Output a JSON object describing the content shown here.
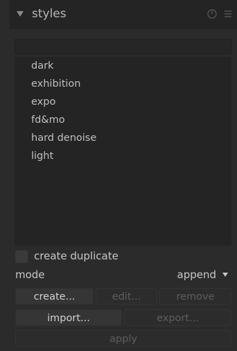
{
  "header": {
    "title": "styles",
    "collapse_icon": "triangle-down-icon",
    "reset_icon": "reset-icon",
    "presets_icon": "presets-menu-icon"
  },
  "search": {
    "value": "",
    "placeholder": ""
  },
  "styles_list": [
    "dark",
    "exhibition",
    "expo",
    "fd&mo",
    "hard denoise",
    "light"
  ],
  "options": {
    "create_duplicate_label": "create duplicate",
    "create_duplicate_checked": false,
    "mode_label": "mode",
    "mode_value": "append"
  },
  "buttons": {
    "create": "create...",
    "edit": "edit...",
    "remove": "remove",
    "import": "import...",
    "export": "export...",
    "apply": "apply"
  },
  "colors": {
    "panel_bg": "#2b2b2b",
    "header_bg": "#242424",
    "list_bg": "#242424",
    "text": "#c8c8c8",
    "disabled_text": "#5e5e5e"
  }
}
